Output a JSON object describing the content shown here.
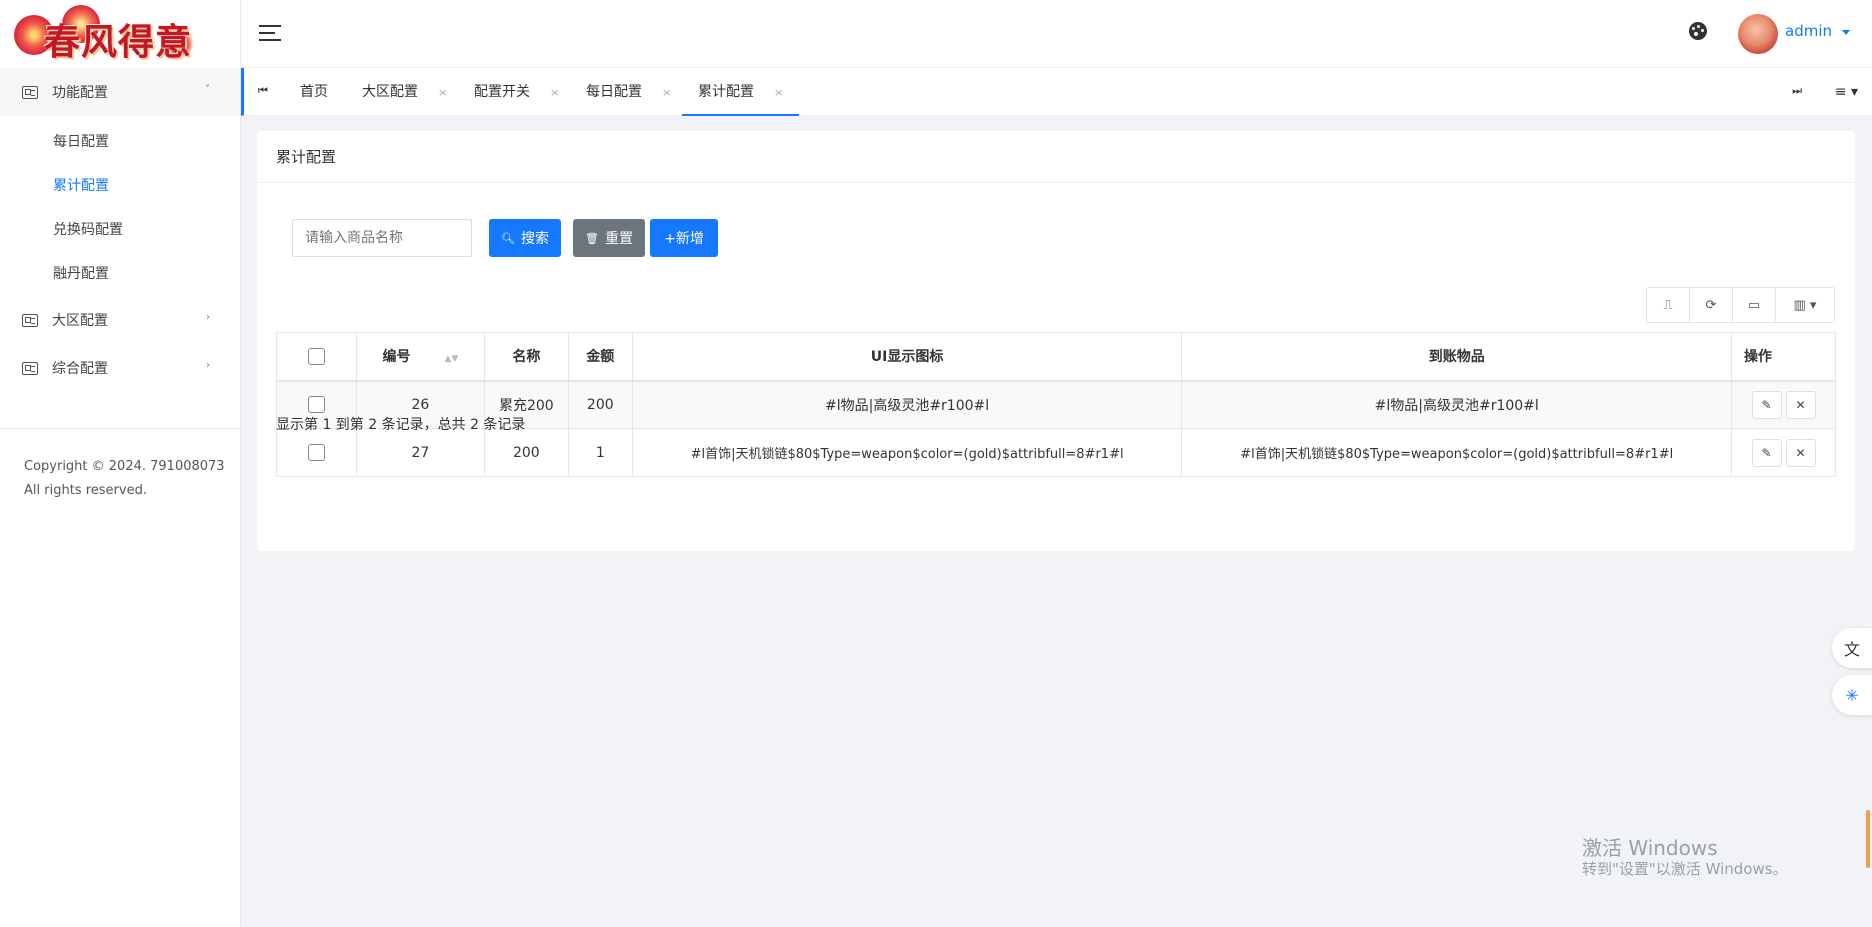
{
  "app": {
    "logo_text": "春风得意"
  },
  "sidebar": {
    "groups": [
      {
        "label": "功能配置",
        "arrow": "˅",
        "expanded": true,
        "items": [
          {
            "label": "每日配置",
            "active": false
          },
          {
            "label": "累计配置",
            "active": true
          },
          {
            "label": "兑换码配置",
            "active": false
          },
          {
            "label": "融丹配置",
            "active": false
          }
        ]
      },
      {
        "label": "大区配置",
        "arrow": "›"
      },
      {
        "label": "综合配置",
        "arrow": "›"
      }
    ],
    "copyright_line1": "Copyright © 2024. 791008073",
    "copyright_line2": "All rights reserved."
  },
  "header": {
    "username": "admin"
  },
  "tabs": {
    "nav_left": "⏮",
    "nav_right": "⏭",
    "menu": "≡ ▾",
    "items": [
      {
        "label": "首页",
        "closable": false
      },
      {
        "label": "大区配置",
        "closable": true
      },
      {
        "label": "配置开关",
        "closable": true
      },
      {
        "label": "每日配置",
        "closable": true
      },
      {
        "label": "累计配置",
        "closable": true,
        "active": true
      }
    ],
    "close_glyph": "×"
  },
  "page": {
    "title": "累计配置",
    "search": {
      "placeholder": "请输入商品名称",
      "value": ""
    },
    "buttons": {
      "search": "搜索",
      "reset": "重置",
      "add": "+新增"
    },
    "table": {
      "columns": [
        "编号",
        "名称",
        "金额",
        "UI显示图标",
        "到账物品",
        "操作"
      ],
      "rows": [
        {
          "id": "26",
          "name": "累充200",
          "amount": "200",
          "ui_icon": "#l物品|高级灵池#r100#l",
          "item": "#l物品|高级灵池#r100#l"
        },
        {
          "id": "27",
          "name": "200",
          "amount": "1",
          "ui_icon": "#l首饰|天机锁链$80$Type=weapon$color=(gold)$attribfull=8#r1#l",
          "item": "#l首饰|天机锁链$80$Type=weapon$color=(gold)$attribfull=8#r1#l"
        }
      ]
    },
    "pager_info": "显示第 1 到第 2 条记录，总共 2 条记录"
  },
  "watermark": {
    "line1": "激活 Windows",
    "line2": "转到\"设置\"以激活 Windows。"
  },
  "colors": {
    "primary": "#1677ff",
    "secondary": "#6c757d",
    "background": "#f1f3f7"
  }
}
